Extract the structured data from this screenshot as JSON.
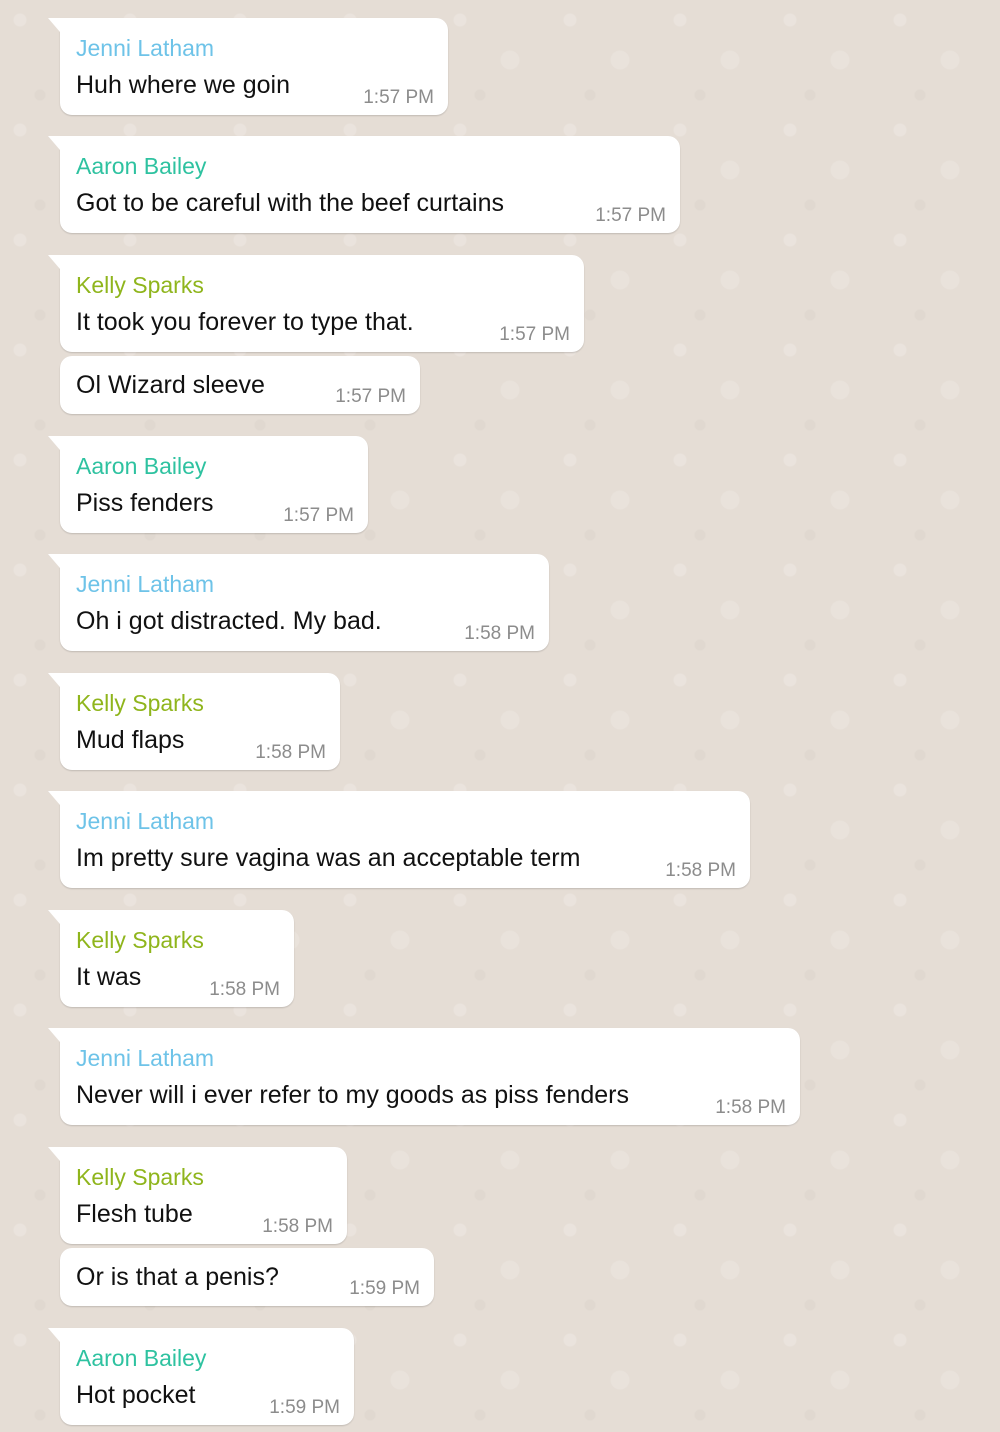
{
  "colors": {
    "chat_background": "#e5ddd5",
    "bubble_background": "#ffffff",
    "name_jenni": "#6ec3e8",
    "name_aaron": "#2ec2a0",
    "name_kelly": "#8fb51c",
    "timestamp": "#8c8c8c"
  },
  "messages": [
    {
      "sender": "Jenni Latham",
      "text": "Huh where we goin",
      "time": "1:57 PM"
    },
    {
      "sender": "Aaron Bailey",
      "text": "Got to be careful with the beef curtains",
      "time": "1:57 PM"
    },
    {
      "sender": "Kelly Sparks",
      "text": "It took you forever to type that.",
      "time": "1:57 PM"
    },
    {
      "sender": "",
      "text": "Ol Wizard sleeve",
      "time": "1:57 PM"
    },
    {
      "sender": "Aaron Bailey",
      "text": "Piss fenders",
      "time": "1:57 PM"
    },
    {
      "sender": "Jenni Latham",
      "text": "Oh i got distracted. My bad.",
      "time": "1:58 PM"
    },
    {
      "sender": "Kelly Sparks",
      "text": "Mud flaps",
      "time": "1:58 PM"
    },
    {
      "sender": "Jenni Latham",
      "text": "Im pretty sure vagina was an acceptable term",
      "time": "1:58 PM"
    },
    {
      "sender": "Kelly Sparks",
      "text": "It was",
      "time": "1:58 PM"
    },
    {
      "sender": "Jenni Latham",
      "text": "Never will i ever refer to my goods as piss fenders",
      "time": "1:58 PM"
    },
    {
      "sender": "Kelly Sparks",
      "text": "Flesh tube",
      "time": "1:58 PM"
    },
    {
      "sender": "",
      "text": "Or is that a penis?",
      "time": "1:59 PM"
    },
    {
      "sender": "Aaron Bailey",
      "text": "Hot pocket",
      "time": "1:59 PM"
    }
  ]
}
